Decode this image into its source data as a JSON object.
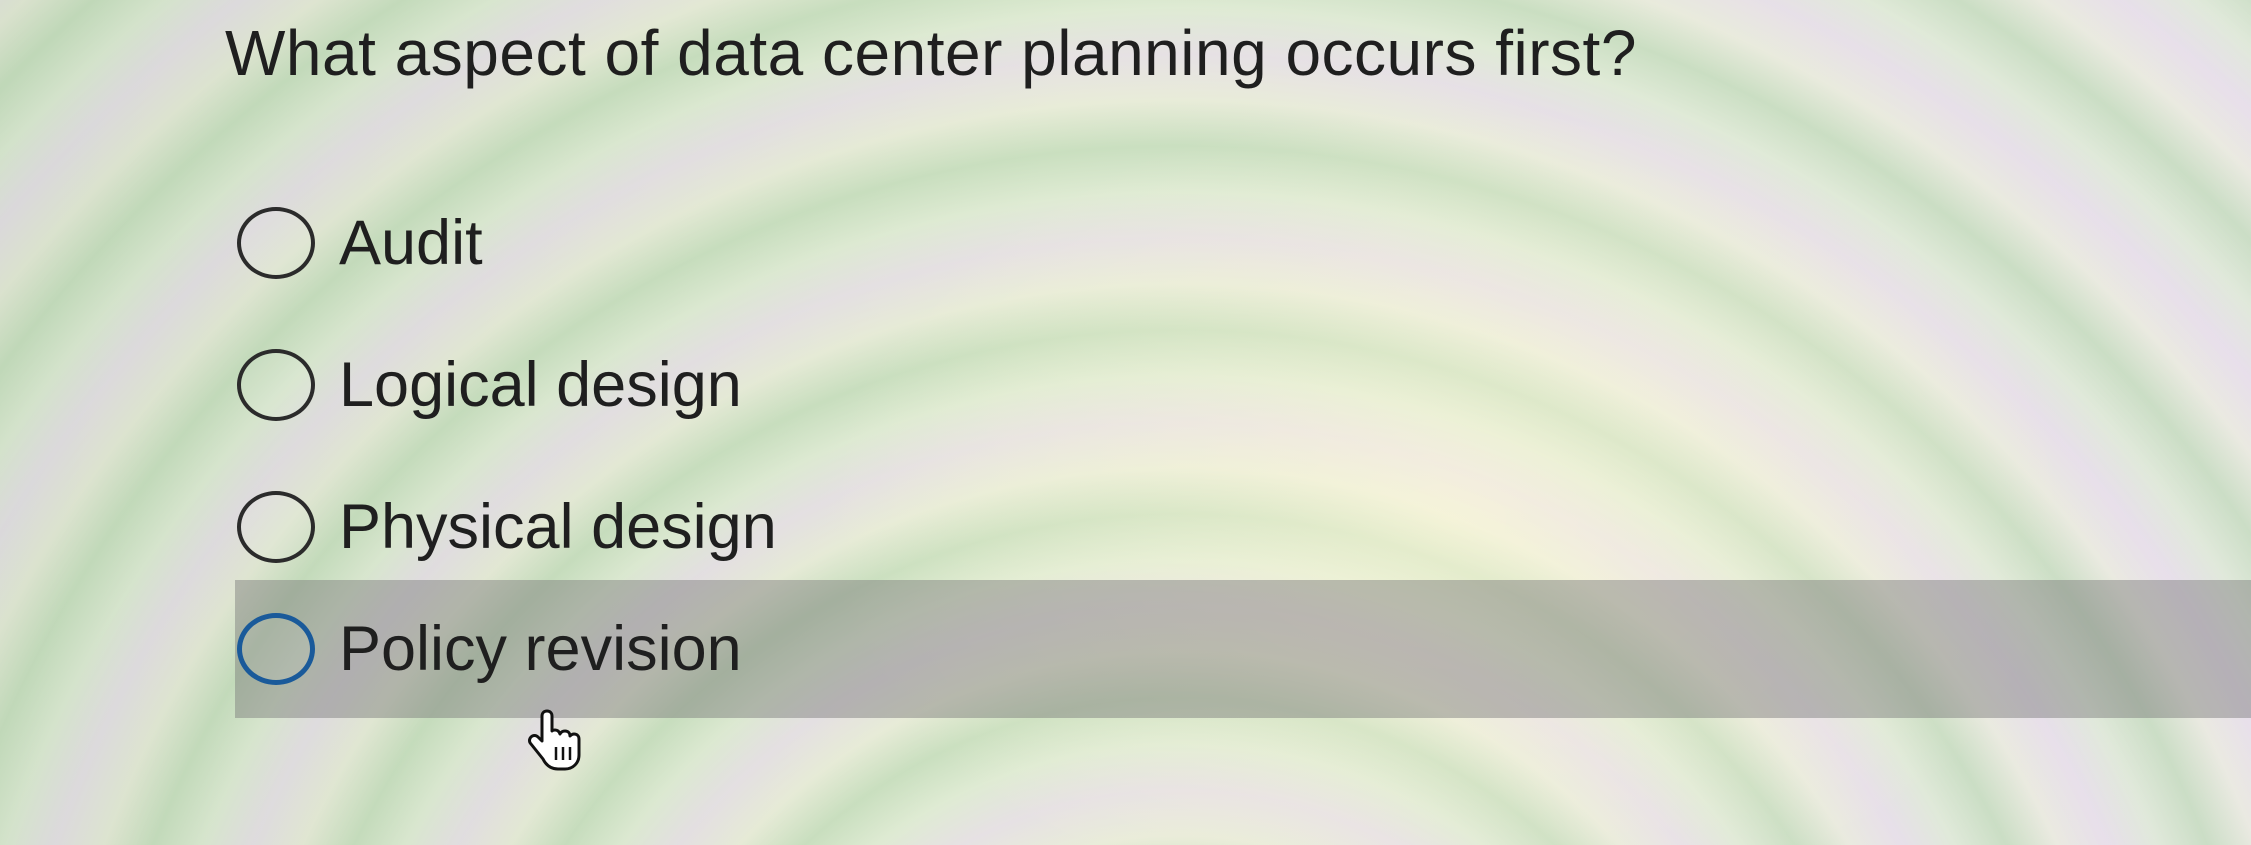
{
  "question": {
    "text": "What aspect of data center planning occurs first?"
  },
  "options": [
    {
      "label": "Audit",
      "selected": false
    },
    {
      "label": "Logical design",
      "selected": false
    },
    {
      "label": "Physical design",
      "selected": false
    },
    {
      "label": "Policy revision",
      "selected": false,
      "hovered": true
    }
  ],
  "colors": {
    "hover_radio_border": "#1a5a9a",
    "radio_border": "#2b2b2b",
    "hover_row_background": "#8a8a8a",
    "text": "#1f1f1f"
  },
  "cursor": {
    "icon": "hand-pointer-icon"
  }
}
